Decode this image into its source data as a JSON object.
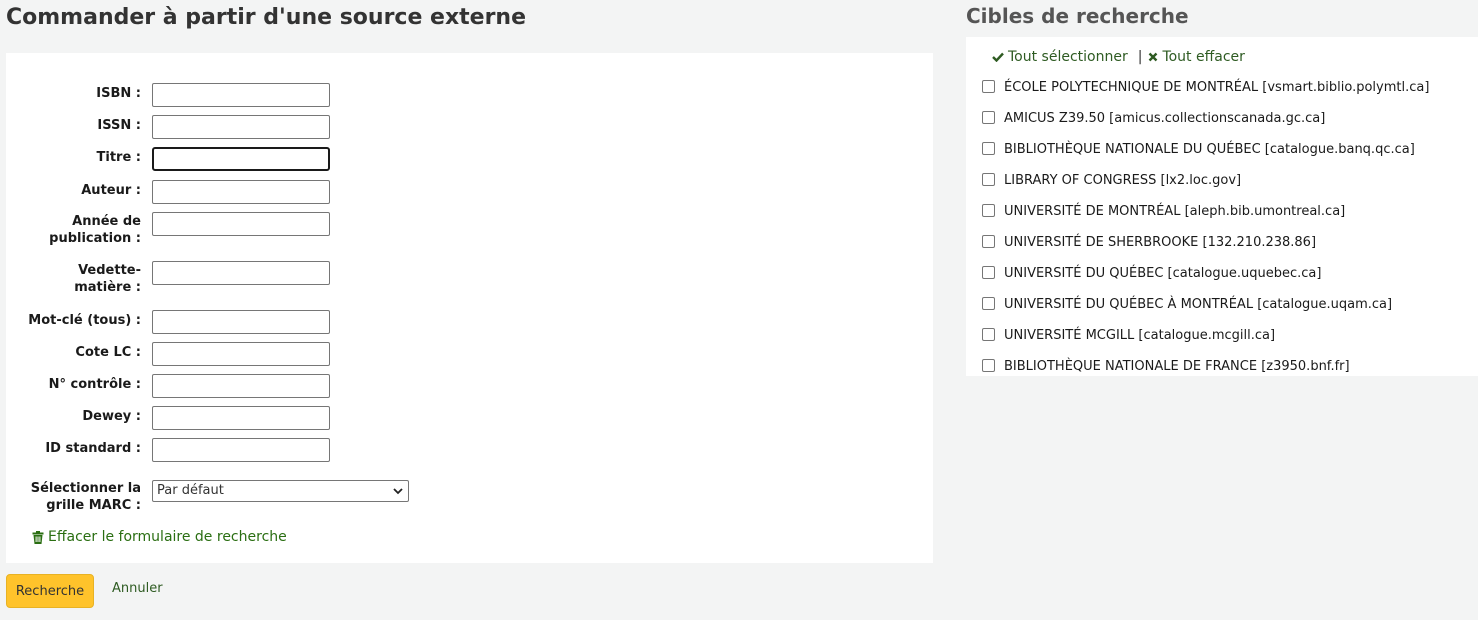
{
  "page_title": "Commander à partir d'une source externe",
  "form": {
    "fields": [
      {
        "label": "ISBN :",
        "value": ""
      },
      {
        "label": "ISSN :",
        "value": ""
      },
      {
        "label": "Titre :",
        "value": ""
      },
      {
        "label": "Auteur :",
        "value": ""
      },
      {
        "label": "Année de",
        "label2": "publication :",
        "value": ""
      },
      {
        "label": "Vedette-",
        "label2": "matière :",
        "value": ""
      },
      {
        "label": "Mot-clé (tous) :",
        "value": ""
      },
      {
        "label": "Cote LC :",
        "value": ""
      },
      {
        "label": "N° contrôle :",
        "value": ""
      },
      {
        "label": "Dewey :",
        "value": ""
      },
      {
        "label": "ID standard :",
        "value": ""
      }
    ],
    "marc_label_1": "Sélectionner la",
    "marc_label_2": "grille MARC :",
    "marc_selected": "Par défaut",
    "clear_label": "Effacer le formulaire de recherche"
  },
  "actions": {
    "search_label": "Recherche",
    "cancel_label": "Annuler"
  },
  "targets": {
    "title": "Cibles de recherche",
    "select_all": "Tout sélectionner",
    "clear_all": "Tout effacer",
    "items": [
      "ÉCOLE POLYTECHNIQUE DE MONTRÉAL [vsmart.biblio.polymtl.ca]",
      "AMICUS Z39.50 [amicus.collectionscanada.gc.ca]",
      "BIBLIOTHÈQUE NATIONALE DU QUÉBEC [catalogue.banq.qc.ca]",
      "LIBRARY OF CONGRESS [lx2.loc.gov]",
      "UNIVERSITÉ DE MONTRÉAL [aleph.bib.umontreal.ca]",
      "UNIVERSITÉ DE SHERBROOKE [132.210.238.86]",
      "UNIVERSITÉ DU QUÉBEC [catalogue.uquebec.ca]",
      "UNIVERSITÉ DU QUÉBEC À MONTRÉAL [catalogue.uqam.ca]",
      "UNIVERSITÉ MCGILL [catalogue.mcgill.ca]",
      "BIBLIOTHÈQUE NATIONALE DE FRANCE [z3950.bnf.fr]"
    ]
  },
  "colors": {
    "accent_link": "#2e5b22",
    "primary_button": "#ffc32b"
  },
  "icons": {
    "select_all": "check-icon",
    "clear_all": "times-icon",
    "clear_form": "trash-icon"
  }
}
